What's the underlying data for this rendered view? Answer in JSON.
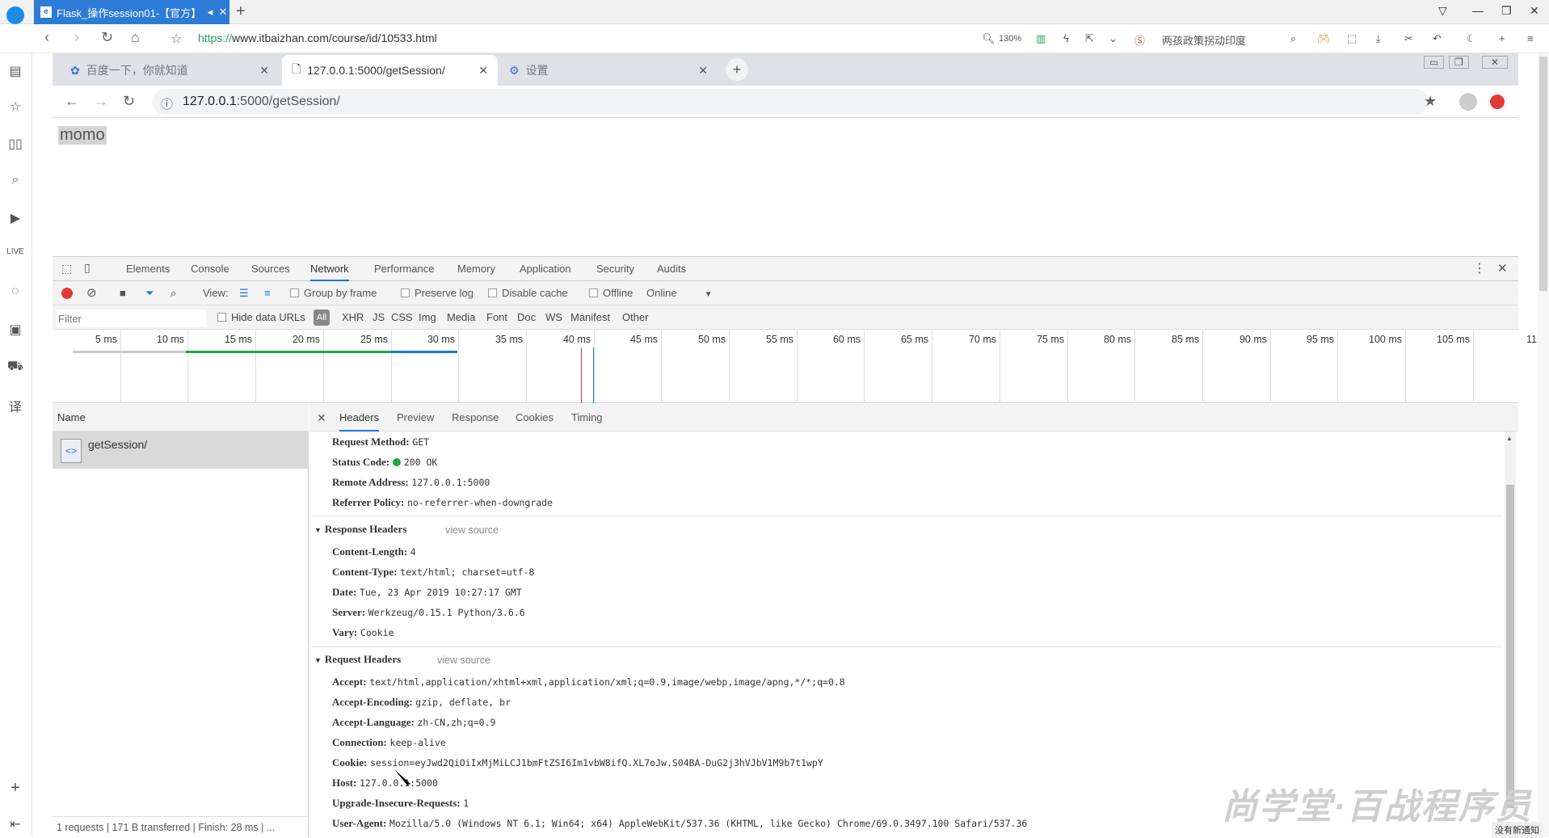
{
  "outer": {
    "tab_title": "Flask_操作session01-【官方】",
    "tab_icon": "e",
    "url_proto": "https://",
    "url_rest": "www.itbaizhan.com/course/id/10533.html",
    "zoom": "130%",
    "news": "两孩政策拐动印度",
    "notice": "没有新通知"
  },
  "inner": {
    "tabs": [
      {
        "label": "百度一下，你就知道"
      },
      {
        "label": "127.0.0.1:5000/getSession/"
      },
      {
        "label": "设置"
      }
    ],
    "url_host": "127.0.0.1",
    "url_path": ":5000/getSession/"
  },
  "page": {
    "text": "momo"
  },
  "devtools": {
    "tabs": [
      "Elements",
      "Console",
      "Sources",
      "Network",
      "Performance",
      "Memory",
      "Application",
      "Security",
      "Audits"
    ],
    "toolbar": {
      "view": "View:",
      "group": "Group by frame",
      "preserve": "Preserve log",
      "cache": "Disable cache",
      "offline": "Offline",
      "online": "Online"
    },
    "filter": {
      "placeholder": "Filter",
      "hide": "Hide data URLs",
      "all": "All",
      "types": [
        "XHR",
        "JS",
        "CSS",
        "Img",
        "Media",
        "Font",
        "Doc",
        "WS",
        "Manifest",
        "Other"
      ]
    },
    "timeline_ticks": [
      "5 ms",
      "10 ms",
      "15 ms",
      "20 ms",
      "25 ms",
      "30 ms",
      "35 ms",
      "40 ms",
      "45 ms",
      "50 ms",
      "55 ms",
      "60 ms",
      "65 ms",
      "70 ms",
      "75 ms",
      "80 ms",
      "85 ms",
      "90 ms",
      "95 ms",
      "100 ms",
      "105 ms",
      "11"
    ],
    "name_header": "Name",
    "request_name": "getSession/",
    "status_bar": "1 requests  |  171 B transferred  |  Finish: 28 ms  |  ...",
    "detail_tabs": [
      "Headers",
      "Preview",
      "Response",
      "Cookies",
      "Timing"
    ],
    "general": [
      {
        "k": "Request Method:",
        "v": "GET"
      },
      {
        "k": "Status Code:",
        "v": "200 OK"
      },
      {
        "k": "Remote Address:",
        "v": "127.0.0.1:5000"
      },
      {
        "k": "Referrer Policy:",
        "v": "no-referrer-when-downgrade"
      }
    ],
    "response_title": "Response Headers",
    "view_source": "view source",
    "response": [
      {
        "k": "Content-Length:",
        "v": "4"
      },
      {
        "k": "Content-Type:",
        "v": "text/html; charset=utf-8"
      },
      {
        "k": "Date:",
        "v": "Tue, 23 Apr 2019 10:27:17 GMT"
      },
      {
        "k": "Server:",
        "v": "Werkzeug/0.15.1 Python/3.6.6"
      },
      {
        "k": "Vary:",
        "v": "Cookie"
      }
    ],
    "request_title": "Request Headers",
    "request": [
      {
        "k": "Accept:",
        "v": "text/html,application/xhtml+xml,application/xml;q=0.9,image/webp,image/apng,*/*;q=0.8"
      },
      {
        "k": "Accept-Encoding:",
        "v": "gzip, deflate, br"
      },
      {
        "k": "Accept-Language:",
        "v": "zh-CN,zh;q=0.9"
      },
      {
        "k": "Connection:",
        "v": "keep-alive"
      },
      {
        "k": "Cookie:",
        "v": "session=eyJwd2QiOiIxMjMiLCJ1bmFtZSI6Im1vbW8ifQ.XL7oJw.S04BA-DuG2j3hVJbV1M9b7t1wpY"
      },
      {
        "k": "Host:",
        "v": "127.0.0.1:5000"
      },
      {
        "k": "Upgrade-Insecure-Requests:",
        "v": "1"
      },
      {
        "k": "User-Agent:",
        "v": "Mozilla/5.0 (Windows NT 6.1; Win64; x64) AppleWebKit/537.36 (KHTML, like Gecko) Chrome/69.0.3497.100 Safari/537.36"
      }
    ]
  },
  "watermark": "尚学堂·百战程序员"
}
